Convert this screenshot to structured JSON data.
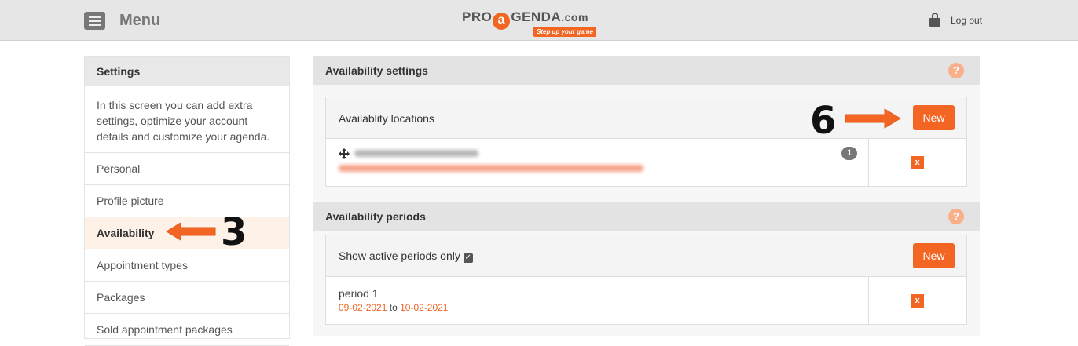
{
  "header": {
    "menu_label": "Menu",
    "logo": {
      "pre": "PRO",
      "a": "a",
      "post": "GENDA",
      "dotcom": ".com",
      "tagline": "Step up your game"
    },
    "logout_label": "Log out"
  },
  "sidebar": {
    "title": "Settings",
    "description": "In this screen you can add extra settings, optimize your account details and customize your agenda.",
    "items": [
      {
        "label": "Personal"
      },
      {
        "label": "Profile picture"
      },
      {
        "label": "Availability",
        "active": true
      },
      {
        "label": "Appointment types"
      },
      {
        "label": "Packages"
      },
      {
        "label": "Sold appointment packages"
      }
    ]
  },
  "availability_settings": {
    "title": "Availability settings",
    "help": "?",
    "locations_label": "Availablity locations",
    "new_label": "New",
    "location_count": "1",
    "delete_label": "x"
  },
  "availability_periods": {
    "title": "Availability periods",
    "help": "?",
    "show_active_label": "Show active periods only",
    "show_active_checked": true,
    "new_label": "New",
    "periods": [
      {
        "name": "period 1",
        "from": "09-02-2021",
        "to_word": "to",
        "to": "10-02-2021",
        "delete_label": "x"
      }
    ]
  },
  "annotations": {
    "step_3": "3",
    "step_6": "6"
  },
  "colors": {
    "accent": "#f26522",
    "help": "#f9b08a"
  }
}
